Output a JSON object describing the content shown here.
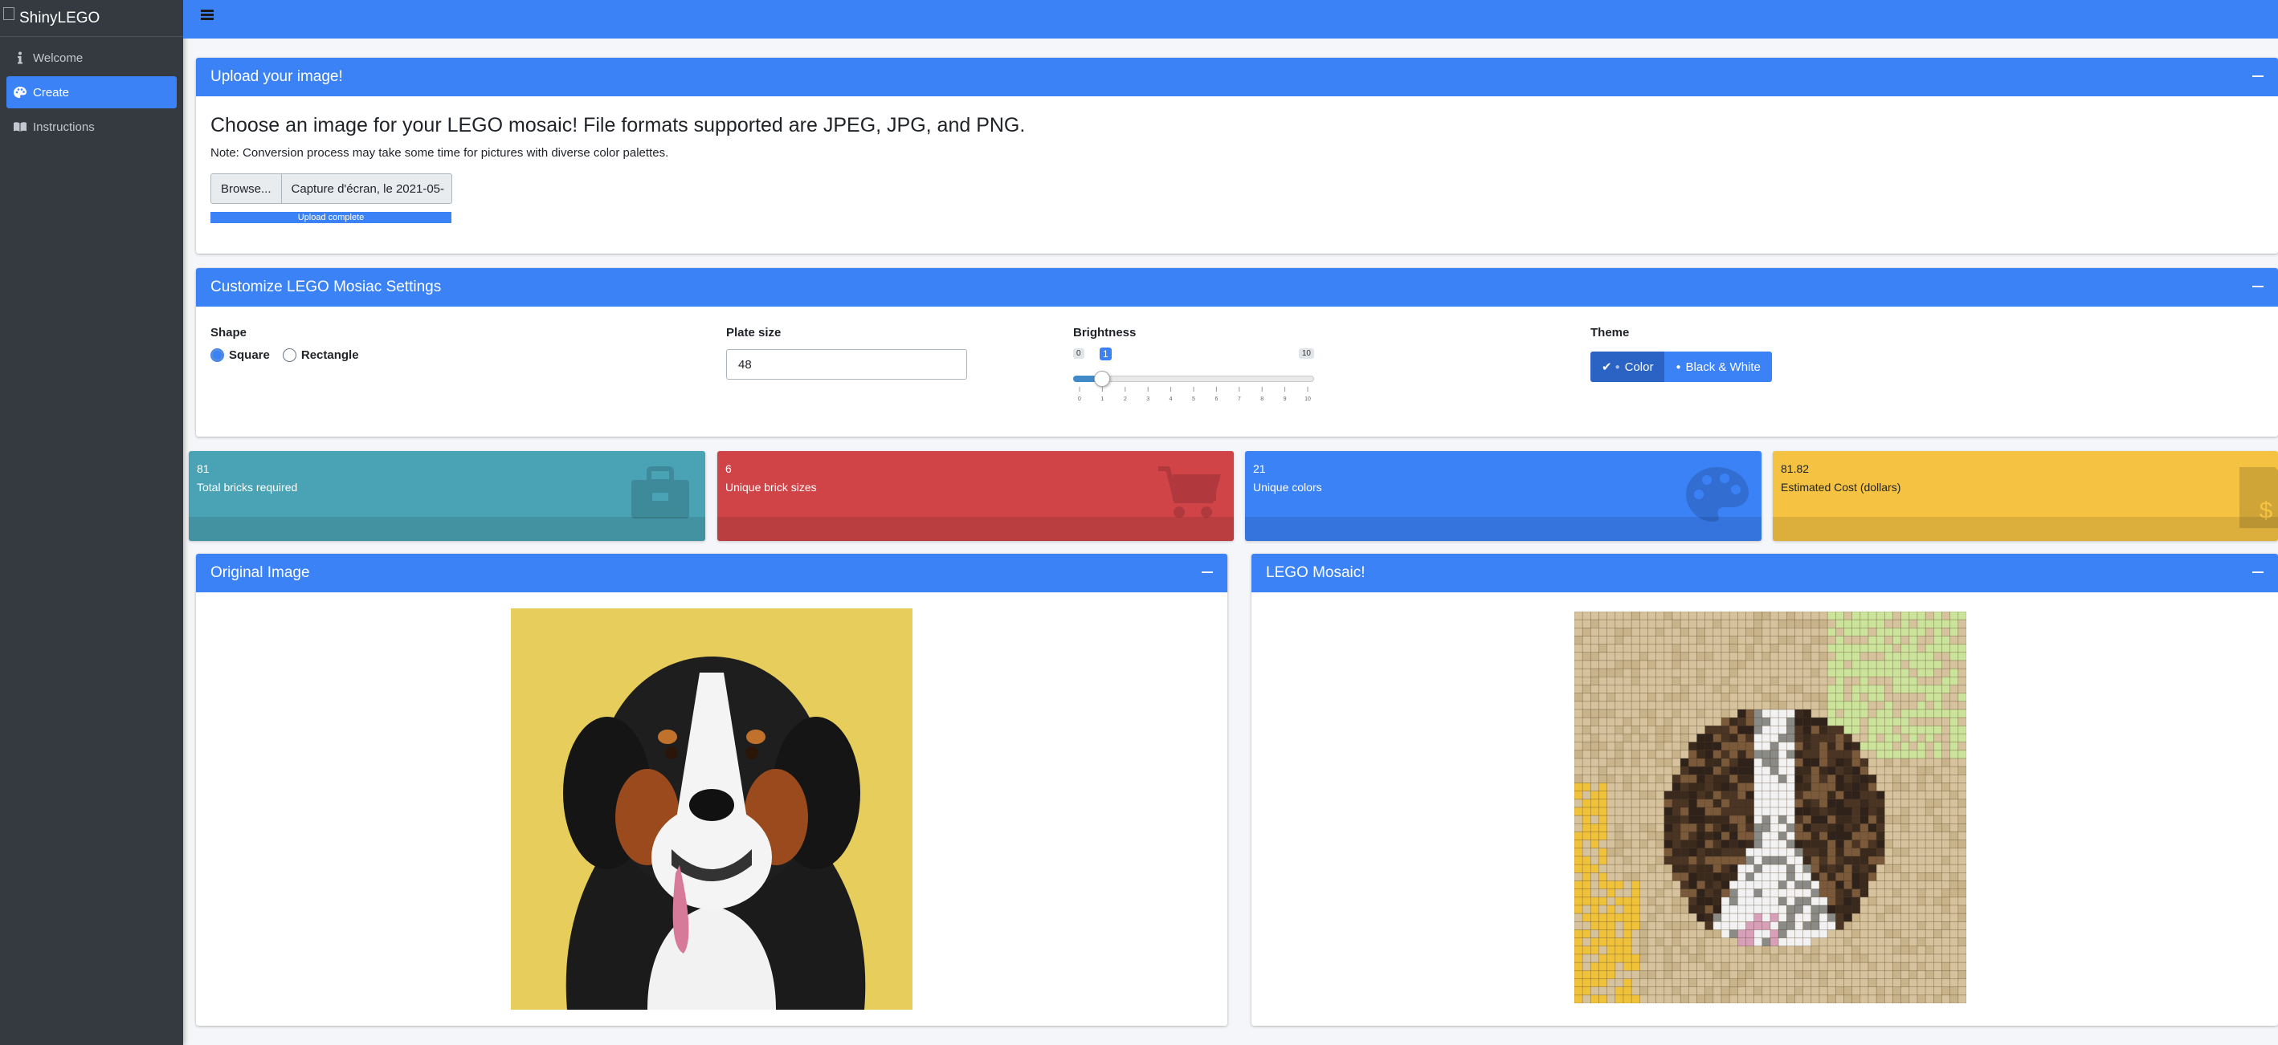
{
  "app": {
    "brand": "ShinyLEGO"
  },
  "sidebar": {
    "items": [
      {
        "label": "Welcome",
        "icon": "info-icon",
        "active": false
      },
      {
        "label": "Create",
        "icon": "palette-icon",
        "active": true
      },
      {
        "label": "Instructions",
        "icon": "book-icon",
        "active": false
      }
    ]
  },
  "upload": {
    "title": "Upload your image!",
    "lead": "Choose an image for your LEGO mosaic! File formats supported are JPEG, JPG, and PNG.",
    "note": "Note: Conversion process may take some time for pictures with diverse color palettes.",
    "browse_label": "Browse...",
    "filename": "Capture d'écran, le 2021-05-",
    "progress_label": "Upload complete",
    "progress": 1.0
  },
  "settings": {
    "title": "Customize LEGO Mosiac Settings",
    "shape": {
      "label": "Shape",
      "options": [
        "Square",
        "Rectangle"
      ],
      "selected": "Square"
    },
    "plate_size": {
      "label": "Plate size",
      "value": "48"
    },
    "brightness": {
      "label": "Brightness",
      "min": "0",
      "max": "10",
      "value": "1",
      "ticks": [
        "0",
        "1",
        "2",
        "3",
        "4",
        "5",
        "6",
        "7",
        "8",
        "9",
        "10"
      ]
    },
    "theme": {
      "label": "Theme",
      "options": [
        "Color",
        "Black & White"
      ],
      "selected": "Color"
    }
  },
  "stats": [
    {
      "value": "81",
      "label": "Total bricks required",
      "color": "#4aa3b5",
      "icon": "toolbox-icon"
    },
    {
      "value": "6",
      "label": "Unique brick sizes",
      "color": "#d04448",
      "icon": "shopping-cart-icon"
    },
    {
      "value": "21",
      "label": "Unique colors",
      "color": "#3b82f6",
      "icon": "palette-icon"
    },
    {
      "value": "81.82",
      "label": "Estimated Cost (dollars)",
      "color": "#f5c242",
      "icon": "invoice-dollar-icon"
    }
  ],
  "original": {
    "title": "Original Image"
  },
  "mosaic": {
    "title": "LEGO Mosaic!"
  },
  "colors": {
    "accent": "#3b82f6",
    "sidebar": "#343a40"
  }
}
